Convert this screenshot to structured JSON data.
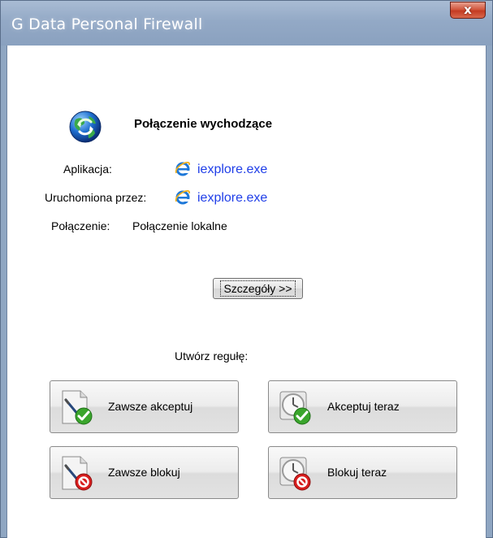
{
  "window": {
    "title": "G Data Personal Firewall",
    "close_glyph": "x"
  },
  "connection": {
    "icon": "globe-icon",
    "heading": "Połączenie wychodzące",
    "application_label": "Aplikacja:",
    "application_value": "iexplore.exe",
    "launched_by_label": "Uruchomiona przez:",
    "launched_by_value": "iexplore.exe",
    "connection_label": "Połączenie:",
    "connection_value": "Połączenie lokalne",
    "app_icon": "internet-explorer-icon"
  },
  "details_button": {
    "label": "Szczegóły >>"
  },
  "rules": {
    "heading": "Utwórz regułę:",
    "buttons": [
      {
        "label": "Zawsze akceptuj",
        "icon": "document-check-icon"
      },
      {
        "label": "Akceptuj teraz",
        "icon": "clock-check-icon"
      },
      {
        "label": "Zawsze blokuj",
        "icon": "document-block-icon"
      },
      {
        "label": "Blokuj teraz",
        "icon": "clock-block-icon"
      }
    ]
  },
  "colors": {
    "link": "#1f3ee8",
    "titlebar": "#93a9c6",
    "close_button": "#c43b22",
    "accept_green": "#3aa52c",
    "block_red": "#d81e1e"
  }
}
